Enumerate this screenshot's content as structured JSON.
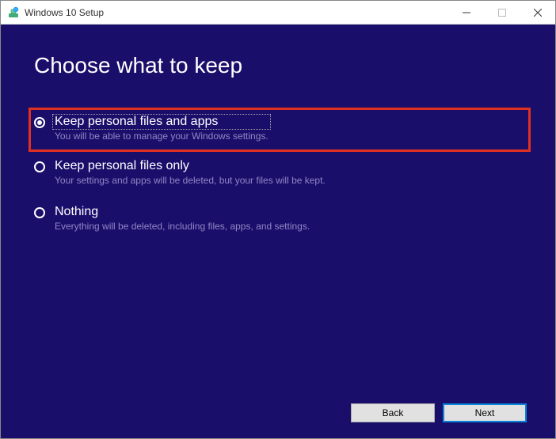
{
  "titlebar": {
    "title": "Windows 10 Setup"
  },
  "heading": "Choose what to keep",
  "options": [
    {
      "label": "Keep personal files and apps",
      "description": "You will be able to manage your Windows settings.",
      "selected": true,
      "highlighted": true
    },
    {
      "label": "Keep personal files only",
      "description": "Your settings and apps will be deleted, but your files will be kept.",
      "selected": false,
      "highlighted": false
    },
    {
      "label": "Nothing",
      "description": "Everything will be deleted, including files, apps, and settings.",
      "selected": false,
      "highlighted": false
    }
  ],
  "buttons": {
    "back": "Back",
    "next": "Next"
  }
}
